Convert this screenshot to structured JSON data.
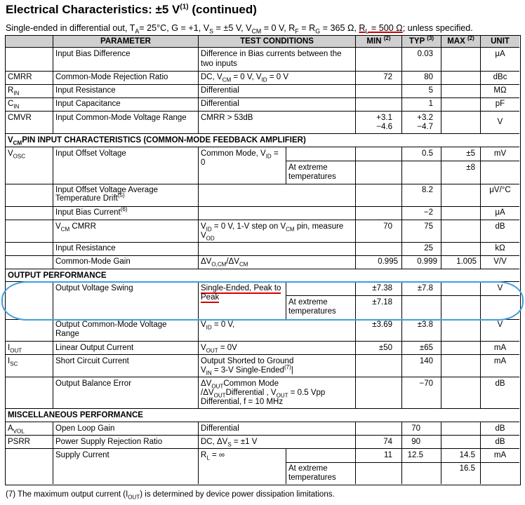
{
  "title": {
    "main": "Electrical Characteristics: ±5 V",
    "sup": "(1)",
    "tail": " (continued)"
  },
  "subtitle": {
    "a": "Single-ended in differential out, T",
    "a_sub": "A",
    "b": "= 25°C, G = +1, V",
    "b_sub": "S",
    "c": " = ±5 V, V",
    "c_sub": "CM",
    "d": " = 0 V, R",
    "d_sub": "F",
    "e": " = R",
    "e_sub": "G",
    "f": " = 365 Ω, ",
    "g": "R",
    "g_sub": "L",
    "h": " = 500 Ω",
    "i": "; unless specified."
  },
  "headers": {
    "parameter": "PARAMETER",
    "conditions": "TEST CONDITIONS",
    "min": "MIN",
    "min_sup": "(2)",
    "typ": "TYP",
    "typ_sup": "(3)",
    "max": "MAX",
    "max_sup": "(2)",
    "unit": "UNIT"
  },
  "rows": {
    "ibd": {
      "param": "Input Bias Difference",
      "cond1": "Difference in Bias currents between the",
      "cond2": "two inputs",
      "typ": "0.03",
      "unit": "μA"
    },
    "cmrr": {
      "sym": "CMRR",
      "param": "Common-Mode Rejection Ratio",
      "cond_a": "DC, V",
      "cond_a_sub": "CM",
      "cond_b": " = 0 V, V",
      "cond_b_sub": "ID",
      "cond_c": " = 0 V",
      "min": "72",
      "typ": "80",
      "unit": "dBc"
    },
    "rin": {
      "sym": "R",
      "sym_sub": "IN",
      "param": "Input Resistance",
      "cond": "Differential",
      "typ": "5",
      "unit": "MΩ"
    },
    "cin": {
      "sym": "C",
      "sym_sub": "IN",
      "param": "Input Capacitance",
      "cond": "Differential",
      "typ": "1",
      "unit": "pF"
    },
    "cmvr": {
      "sym": "CMVR",
      "param": "Input Common-Mode Voltage Range",
      "cond": "CMRR > 53dB",
      "min1": "+3.1",
      "min2": "−4.6",
      "typ1": "+3.2",
      "typ2": "−4.7",
      "unit": "V"
    },
    "vcm_sec": {
      "a": "V",
      "a_sub": "CM",
      "b": "PIN INPUT CHARACTERISTICS (COMMON-MODE FEEDBACK AMPLIFIER)"
    },
    "vosc": {
      "sym": "V",
      "sym_sub": "OSC",
      "param": "Input Offset Voltage",
      "cond1": "Common Mode, V",
      "cond1_sub": "ID",
      "cond1_b": " =",
      "cond2": "0",
      "typ": "0.5",
      "max": "±5",
      "unit": "mV",
      "ext1": "At extreme",
      "ext2": "temperatures",
      "ext_max": "±8"
    },
    "iovad": {
      "param1": "Input Offset Voltage Average",
      "param2": "Temperature Drift",
      "param2_sup": "(5)",
      "typ": "8.2",
      "unit": "μV/°C"
    },
    "ibc": {
      "param": "Input Bias Current",
      "param_sup": "(6)",
      "typ": "−2",
      "unit": "μA"
    },
    "vcmrr": {
      "param_a": "V",
      "param_a_sub": "CM",
      "param_b": " CMRR",
      "cond1_a": "V",
      "cond1_a_sub": "ID",
      "cond1_b": " = 0 V, 1-V step on V",
      "cond1_b_sub": "CM",
      "cond1_c": " pin, measure",
      "cond2": "V",
      "cond2_sub": "OD",
      "min": "70",
      "typ": "75",
      "unit": "dB"
    },
    "irin": {
      "param": "Input Resistance",
      "typ": "25",
      "unit": "kΩ"
    },
    "cmg": {
      "param": "Common-Mode Gain",
      "cond_a": "ΔV",
      "cond_a_sub": "O,CM",
      "cond_b": "/ΔV",
      "cond_b_sub": "CM",
      "min": "0.995",
      "typ": "0.999",
      "max": "1.005",
      "unit": "V/V"
    },
    "out_sec": {
      "label": "OUTPUT PERFORMANCE"
    },
    "ovs": {
      "param": "Output Voltage Swing",
      "cond1": "Single-Ended, Peak to",
      "cond2": "Peak",
      "min": "±7.38",
      "typ": "±7.8",
      "unit": "V",
      "ext1": "At extreme",
      "ext2": "temperatures",
      "ext_min": "±7.18"
    },
    "ocmv": {
      "param1": "Output Common-Mode Voltage",
      "param2": "Range",
      "cond_a": "V",
      "cond_a_sub": "ID",
      "cond_b": " = 0 V,",
      "min": "±3.69",
      "typ": "±3.8",
      "unit": "V"
    },
    "iout": {
      "sym": "I",
      "sym_sub": "OUT",
      "param": "Linear Output Current",
      "cond_a": "V",
      "cond_a_sub": "OUT",
      "cond_b": " = 0V",
      "min": "±50",
      "typ": "±65",
      "unit": "mA"
    },
    "isc": {
      "sym": "I",
      "sym_sub": "SC",
      "param": "Short Circuit Current",
      "cond1": "Output Shorted to Ground",
      "cond2_a": "V",
      "cond2_a_sub": "IN",
      "cond2_b": " = 3-V Single-Ended",
      "cond2_sup": "(7)",
      "typ": "140",
      "unit": "mA"
    },
    "obe": {
      "param": "Output Balance Error",
      "cond1_a": "ΔV",
      "cond1_a_sub": "OUT",
      "cond1_b": "Common Mode",
      "cond2_a": "/ΔV",
      "cond2_a_sub": "OUT",
      "cond2_b": "Differential , V",
      "cond2_b_sub": "OUT",
      "cond2_c": " = 0.5 Vpp",
      "cond3": "Differential, f = 10 MHz",
      "typ": "−70",
      "unit": "dB"
    },
    "misc_sec": {
      "label": "MISCELLANEOUS PERFORMANCE"
    },
    "avol": {
      "sym": "A",
      "sym_sub": "VOL",
      "param": "Open Loop Gain",
      "cond": "Differential",
      "typ": "70",
      "unit": "dB"
    },
    "psrr": {
      "sym": "PSRR",
      "param": "Power Supply Rejection Ratio",
      "cond_a": "DC, ΔV",
      "cond_a_sub": "S",
      "cond_b": " = ±1 V",
      "min": "74",
      "typ": "90",
      "unit": "dB"
    },
    "sc": {
      "param": "Supply Current",
      "cond_a": "R",
      "cond_a_sub": "L",
      "cond_b": " = ∞",
      "min": "11",
      "typ": "12.5",
      "max": "14.5",
      "unit": "mA",
      "ext1": "At extreme",
      "ext2": "temperatures",
      "ext_max": "16.5"
    }
  },
  "footnote": {
    "a": "(7)   The maximum output current (I",
    "a_sub": "OUT",
    "b": ") is determined by device power dissipation limitations."
  },
  "colors": {
    "header_bg": "#cfcfcf",
    "highlight": "#3f9fe0",
    "underline": "#d40000"
  }
}
